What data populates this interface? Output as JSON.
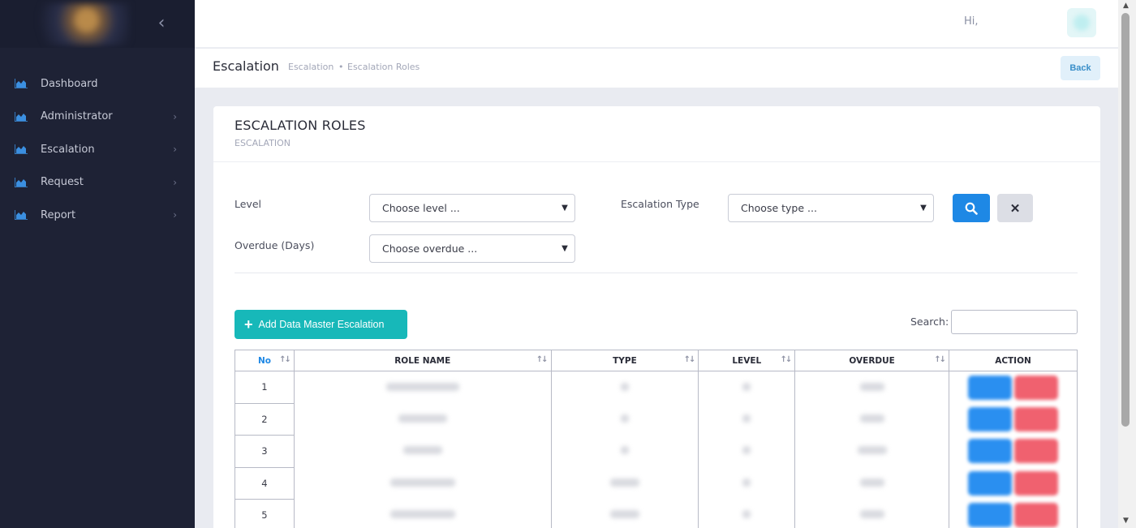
{
  "sidebar": {
    "items": [
      {
        "label": "Dashboard",
        "icon": "chart-icon",
        "has_children": false
      },
      {
        "label": "Administrator",
        "icon": "chart-icon",
        "has_children": true
      },
      {
        "label": "Escalation",
        "icon": "chart-icon",
        "has_children": true
      },
      {
        "label": "Request",
        "icon": "chart-icon",
        "has_children": true
      },
      {
        "label": "Report",
        "icon": "chart-icon",
        "has_children": true
      }
    ]
  },
  "topbar": {
    "greeting": "Hi,"
  },
  "subheader": {
    "title": "Escalation",
    "breadcrumb": [
      "Escalation",
      "Escalation Roles"
    ],
    "back_label": "Back"
  },
  "card": {
    "title": "ESCALATION ROLES",
    "subtitle": "ESCALATION"
  },
  "filters": {
    "level_label": "Level",
    "level_placeholder": "Choose level ...",
    "type_label": "Escalation Type",
    "type_placeholder": "Choose type ...",
    "overdue_label": "Overdue (Days)",
    "overdue_placeholder": "Choose overdue ..."
  },
  "toolbar": {
    "add_label": "Add Data Master Escalation",
    "search_label": "Search:",
    "search_value": ""
  },
  "table": {
    "headers": [
      "No",
      "ROLE NAME",
      "TYPE",
      "LEVEL",
      "OVERDUE",
      "ACTION"
    ],
    "rows": [
      {
        "no": "1"
      },
      {
        "no": "2"
      },
      {
        "no": "3"
      },
      {
        "no": "4"
      },
      {
        "no": "5"
      }
    ]
  },
  "colors": {
    "sidebar_bg": "#1e2235",
    "primary": "#1e88e5",
    "teal": "#17b8b9",
    "danger": "#f0616f"
  }
}
